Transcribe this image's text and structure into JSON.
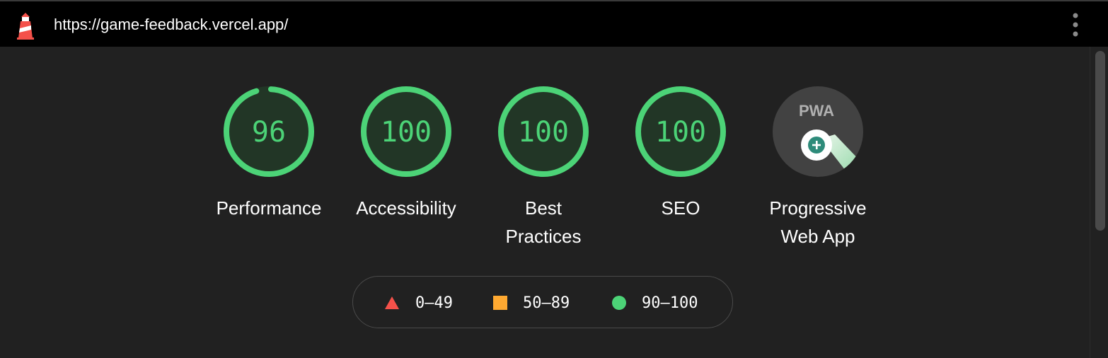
{
  "topbar": {
    "url": "https://game-feedback.vercel.app/"
  },
  "gauges": [
    {
      "score": "96",
      "score_fraction": 0.96,
      "label": "Performance"
    },
    {
      "score": "100",
      "score_fraction": 1.0,
      "label": "Accessibility"
    },
    {
      "score": "100",
      "score_fraction": 1.0,
      "label": "Best Practices"
    },
    {
      "score": "100",
      "score_fraction": 1.0,
      "label": "SEO"
    }
  ],
  "pwa": {
    "badge_text": "PWA",
    "label": "Progressive Web App"
  },
  "legend": {
    "fail": "0–49",
    "average": "50–89",
    "pass": "90–100"
  },
  "colors": {
    "pass": "#4cd377",
    "average": "#ffa931",
    "fail": "#f4514a",
    "background": "#212121",
    "topbar": "#000000"
  },
  "icons": {
    "logo": "lighthouse-icon",
    "menu": "vertical-dots-icon",
    "pwa": "pwa-badge-icon"
  }
}
